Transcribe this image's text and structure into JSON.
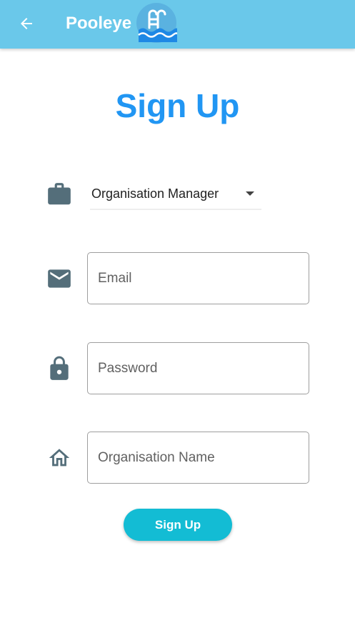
{
  "app_bar": {
    "title": "Pooleye",
    "back_icon": "arrow-left-icon",
    "logo_icon": "pool-ladder-icon",
    "background_color": "#6ac8ea"
  },
  "page": {
    "title": "Sign Up",
    "title_color": "#2196f3"
  },
  "form": {
    "role": {
      "icon": "briefcase-icon",
      "selected": "Organisation Manager"
    },
    "email": {
      "icon": "envelope-icon",
      "placeholder": "Email",
      "value": ""
    },
    "password": {
      "icon": "lock-icon",
      "placeholder": "Password",
      "value": ""
    },
    "organisation": {
      "icon": "home-icon",
      "placeholder": "Organisation Name",
      "value": ""
    },
    "submit_label": "Sign Up",
    "submit_color": "#13bcd4",
    "icon_color": "#546e7a"
  }
}
